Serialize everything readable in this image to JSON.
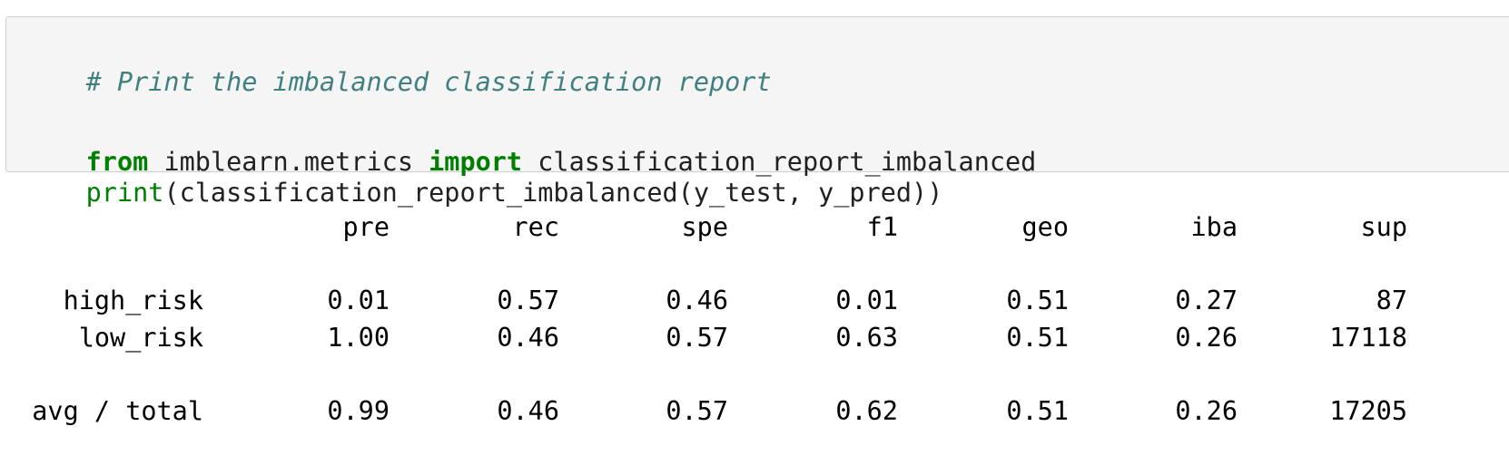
{
  "code": {
    "comment": "# Print the imbalanced classification report",
    "line2": {
      "kw_from": "from",
      "module": " imblearn.metrics ",
      "kw_import": "import",
      "name": " classification_report_imbalanced"
    },
    "line3": {
      "builtin": "print",
      "rest": "(classification_report_imbalanced(y_test, y_pred))"
    }
  },
  "report": {
    "headers": [
      "pre",
      "rec",
      "spe",
      "f1",
      "geo",
      "iba",
      "sup"
    ],
    "rows": [
      {
        "label": "high_risk",
        "values": [
          "0.01",
          "0.57",
          "0.46",
          "0.01",
          "0.51",
          "0.27",
          "87"
        ]
      },
      {
        "label": "low_risk",
        "values": [
          "1.00",
          "0.46",
          "0.57",
          "0.63",
          "0.51",
          "0.26",
          "17118"
        ]
      }
    ],
    "total": {
      "label": "avg / total",
      "values": [
        "0.99",
        "0.46",
        "0.57",
        "0.62",
        "0.51",
        "0.26",
        "17205"
      ]
    }
  }
}
